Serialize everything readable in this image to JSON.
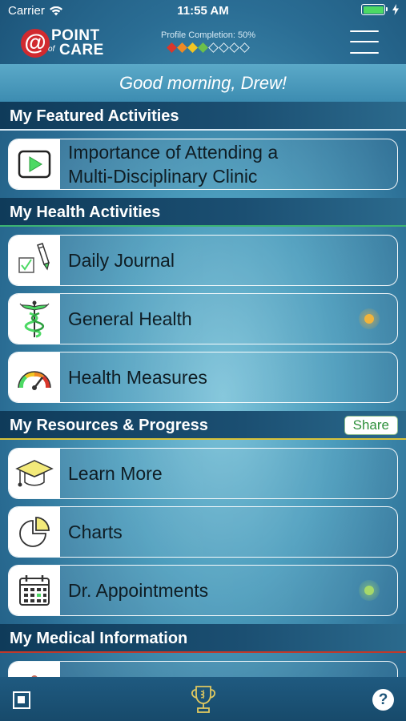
{
  "status_bar": {
    "carrier": "Carrier",
    "time": "11:55 AM"
  },
  "header": {
    "logo": {
      "point": "POINT",
      "of": "of",
      "care": "CARE"
    },
    "profile_completion": "Profile Completion: 50%",
    "profile_diamonds": [
      "#d9372b",
      "#f08a24",
      "#f3c623",
      "#6cc04a",
      "",
      "",
      "",
      ""
    ]
  },
  "greeting": "Good morning, Drew!",
  "sections": {
    "featured": {
      "title": "My Featured Activities"
    },
    "health": {
      "title": "My Health Activities"
    },
    "resources": {
      "title": "My Resources & Progress",
      "share_label": "Share"
    },
    "medical": {
      "title": "My Medical Information"
    }
  },
  "cards": {
    "featured": {
      "label_line1": "Importance of Attending a",
      "label_line2": "Multi-Disciplinary Clinic",
      "icon": "video-play-icon"
    },
    "daily_journal": {
      "label": "Daily Journal",
      "icon": "journal-pencil-icon"
    },
    "general_health": {
      "label": "General Health",
      "icon": "caduceus-icon",
      "dot_color": "#f0b43c"
    },
    "health_measures": {
      "label": "Health Measures",
      "icon": "gauge-icon"
    },
    "learn_more": {
      "label": "Learn More",
      "icon": "graduation-cap-icon"
    },
    "charts": {
      "label": "Charts",
      "icon": "pie-chart-icon"
    },
    "appointments": {
      "label": "Dr. Appointments",
      "icon": "calendar-icon",
      "dot_color": "#a6d96a"
    },
    "medical_partial": {
      "icon": "medical-info-icon"
    }
  },
  "tab_bar": {
    "left_icon": "square-icon",
    "center_icon": "trophy-icon",
    "help_label": "?"
  }
}
